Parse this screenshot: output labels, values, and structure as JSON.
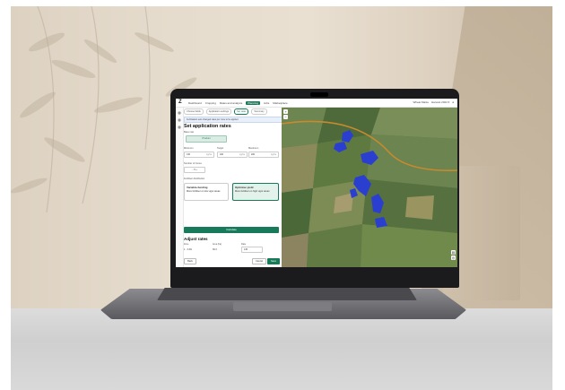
{
  "nav": {
    "logo": "Z",
    "items": [
      "Dashboard",
      "Cropping",
      "Rates and analysis",
      "Planning",
      "Jobs",
      "Marketplace"
    ],
    "active_index": 3,
    "right_items": [
      "Wheat Maize",
      "Harvest 2024 ▾"
    ]
  },
  "steps": [
    "Choose fields",
    "Application settings",
    "Set rates",
    "Summary"
  ],
  "current_step": 2,
  "panel": {
    "info": "Fertilisation sets changed rates per zone to be applied",
    "title": "Set application rates",
    "base_rate_label": "Base rate",
    "base_rate_value": "Product",
    "minimum_label": "Minimum",
    "minimum_value": "130",
    "target_label": "Target",
    "target_value": "160",
    "maximum_label": "Maximum",
    "maximum_value": "200",
    "unit": "kg/ha",
    "zones_label": "Number of zones",
    "zones_value": "5",
    "distribution_label": "Fertiliser distribution",
    "option1_title": "Variable-funding",
    "option1_desc": "More fertiliser on low vigor areas",
    "option2_title": "Optimise yield",
    "option2_desc": "More fertiliser on high vigor areas",
    "calculate_label": "Calculate",
    "adjust_title": "Adjust rates",
    "col_zone": "Zone",
    "col_area": "Area (ha)",
    "col_rate": "Rate",
    "row1_zone": "1 · 3.4%",
    "row1_area": "36.3",
    "row1_rate": "145",
    "back_label": "Back",
    "cancel_label": "Cancel",
    "save_label": "Save"
  },
  "colors": {
    "accent": "#177a5a",
    "zone": "#2a3fcf",
    "road": "#c98a2e"
  },
  "map": {
    "zoom_in": "+",
    "zoom_out": "−",
    "layers_icon": "layers-icon"
  }
}
